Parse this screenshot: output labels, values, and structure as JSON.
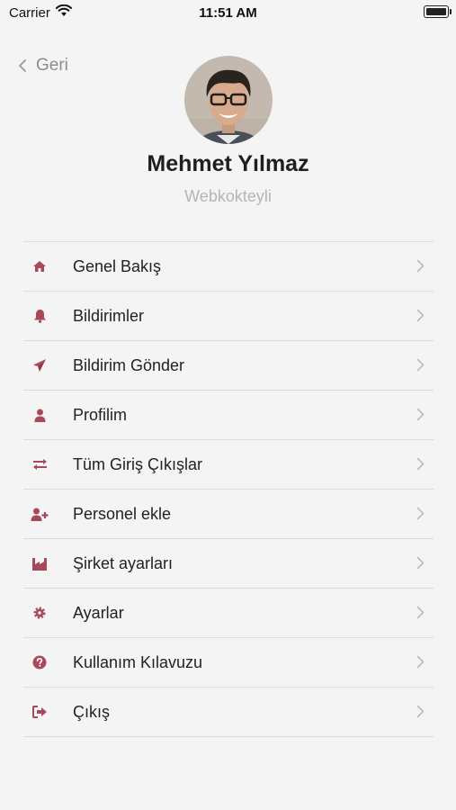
{
  "status_bar": {
    "carrier": "Carrier",
    "time": "11:51 AM"
  },
  "nav": {
    "back_label": "Geri"
  },
  "profile": {
    "name": "Mehmet Yılmaz",
    "company": "Webkokteyli"
  },
  "colors": {
    "accent": "#a8495b",
    "text": "#222222",
    "muted": "#b5b5b5",
    "divider": "#dcdcdc"
  },
  "menu": [
    {
      "label": "Genel Bakış",
      "icon": "home-icon"
    },
    {
      "label": "Bildirimler",
      "icon": "bell-icon"
    },
    {
      "label": "Bildirim Gönder",
      "icon": "paper-plane-icon"
    },
    {
      "label": "Profilim",
      "icon": "user-icon"
    },
    {
      "label": "Tüm Giriş Çıkışlar",
      "icon": "exchange-icon"
    },
    {
      "label": "Personel ekle",
      "icon": "user-plus-icon"
    },
    {
      "label": "Şirket ayarları",
      "icon": "industry-icon"
    },
    {
      "label": "Ayarlar",
      "icon": "gear-icon"
    },
    {
      "label": "Kullanım Kılavuzu",
      "icon": "question-circle-icon"
    },
    {
      "label": "Çıkış",
      "icon": "sign-out-icon"
    }
  ]
}
